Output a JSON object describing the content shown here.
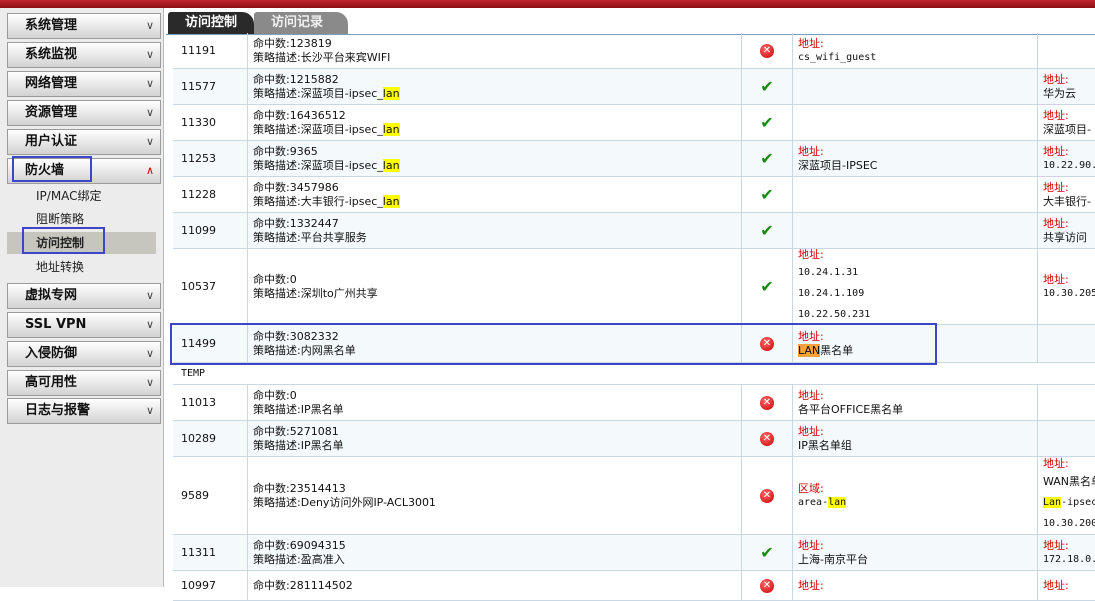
{
  "sidebar": {
    "menus": [
      {
        "label": "系统管理",
        "chevron": "expand"
      },
      {
        "label": "系统监视",
        "chevron": "expand"
      },
      {
        "label": "网络管理",
        "chevron": "expand"
      },
      {
        "label": "资源管理",
        "chevron": "expand"
      },
      {
        "label": "用户认证",
        "chevron": "expand"
      },
      {
        "label": "防火墙",
        "chevron": "collapse"
      },
      {
        "label": "虚拟专网",
        "chevron": "expand"
      },
      {
        "label": "SSL VPN",
        "chevron": "expand"
      },
      {
        "label": "入侵防御",
        "chevron": "expand"
      },
      {
        "label": "高可用性",
        "chevron": "expand"
      },
      {
        "label": "日志与报警",
        "chevron": "expand"
      }
    ],
    "firewall_items": [
      "IP/MAC绑定",
      "阻断策略",
      "访问控制",
      "地址转换"
    ],
    "active_item": "访问控制"
  },
  "tabs": {
    "active": "访问控制",
    "inactive": "访问记录"
  },
  "labels": {
    "hits": "命中数:",
    "desc": "策略描述:",
    "address": "地址:",
    "zone": "区域:"
  },
  "group_label": "TEMP",
  "rows": [
    {
      "id": "11191",
      "hits": "123819",
      "desc": "长沙平台来宾WIFI",
      "action": "deny",
      "src": {
        "label": "地址:",
        "values": [
          "cs_wifi_guest"
        ]
      },
      "dst": {
        "label": "",
        "values": []
      }
    },
    {
      "id": "11577",
      "hits": "1215882",
      "desc": "深蓝项目-ipsec_lan",
      "action": "allow",
      "src": {
        "label": "",
        "values": []
      },
      "dst": {
        "label": "地址:",
        "values": [
          "华为云"
        ]
      }
    },
    {
      "id": "11330",
      "hits": "16436512",
      "desc": "深蓝项目-ipsec_lan",
      "action": "allow",
      "src": {
        "label": "",
        "values": []
      },
      "dst": {
        "label": "地址:",
        "values": [
          "深蓝项目-"
        ]
      }
    },
    {
      "id": "11253",
      "hits": "9365",
      "desc": "深蓝项目-ipsec_lan",
      "action": "allow",
      "src": {
        "label": "地址:",
        "values": [
          "深蓝项目-IPSEC"
        ]
      },
      "dst": {
        "label": "地址:",
        "values": [
          "10.22.90."
        ]
      }
    },
    {
      "id": "11228",
      "hits": "3457986",
      "desc": "大丰银行-ipsec_lan",
      "action": "allow",
      "src": {
        "label": "",
        "values": []
      },
      "dst": {
        "label": "地址:",
        "values": [
          "大丰银行-"
        ]
      }
    },
    {
      "id": "11099",
      "hits": "1332447",
      "desc": "平台共享服务",
      "action": "allow",
      "src": {
        "label": "",
        "values": []
      },
      "dst": {
        "label": "地址:",
        "values": [
          "共享访问"
        ]
      }
    },
    {
      "id": "10537",
      "hits": "0",
      "desc": "深圳to广州共享",
      "action": "allow",
      "src": {
        "label": "地址:",
        "values": [
          "10.24.1.31",
          "10.24.1.109",
          "10.22.50.231"
        ]
      },
      "dst": {
        "label": "地址:",
        "values": [
          "10.30.205"
        ]
      }
    },
    {
      "id": "11499",
      "hits": "3082332",
      "desc": "内网黑名单",
      "action": "deny",
      "src": {
        "label": "地址:",
        "values": [
          "LAN黑名单"
        ]
      },
      "dst": {
        "label": "",
        "values": []
      }
    },
    {
      "id": "11013",
      "hits": "0",
      "desc": "IP黑名单",
      "action": "deny",
      "src": {
        "label": "地址:",
        "values": [
          "各平台OFFICE黑名单"
        ]
      },
      "dst": {
        "label": "",
        "values": []
      }
    },
    {
      "id": "10289",
      "hits": "5271081",
      "desc": "IP黑名单",
      "action": "deny",
      "src": {
        "label": "地址:",
        "values": [
          "IP黑名单组"
        ]
      },
      "dst": {
        "label": "",
        "values": []
      }
    },
    {
      "id": "9589",
      "hits": "23514413",
      "desc": "Deny访问外网IP-ACL3001",
      "action": "deny",
      "src": {
        "label": "区域:",
        "values": [
          "area-lan"
        ]
      },
      "dst": {
        "label": "地址:",
        "values": [
          "WAN黑名单",
          "Lan-ipsec",
          "10.30.200"
        ]
      }
    },
    {
      "id": "11311",
      "hits": "69094315",
      "desc": "盈高准入",
      "action": "allow",
      "src": {
        "label": "地址:",
        "values": [
          "上海-南京平台"
        ]
      },
      "dst": {
        "label": "地址:",
        "values": [
          "172.18.0."
        ]
      }
    },
    {
      "id": "10997",
      "hits": "281114502",
      "desc": "",
      "action": "deny",
      "src": {
        "label": "地址:",
        "values": []
      },
      "dst": {
        "label": "地址:",
        "values": []
      }
    }
  ],
  "colors": {
    "accent_red": "#c0262b",
    "highlight_box": "#3b47c6",
    "deny": "#c40000",
    "allow": "#1c8a12"
  }
}
